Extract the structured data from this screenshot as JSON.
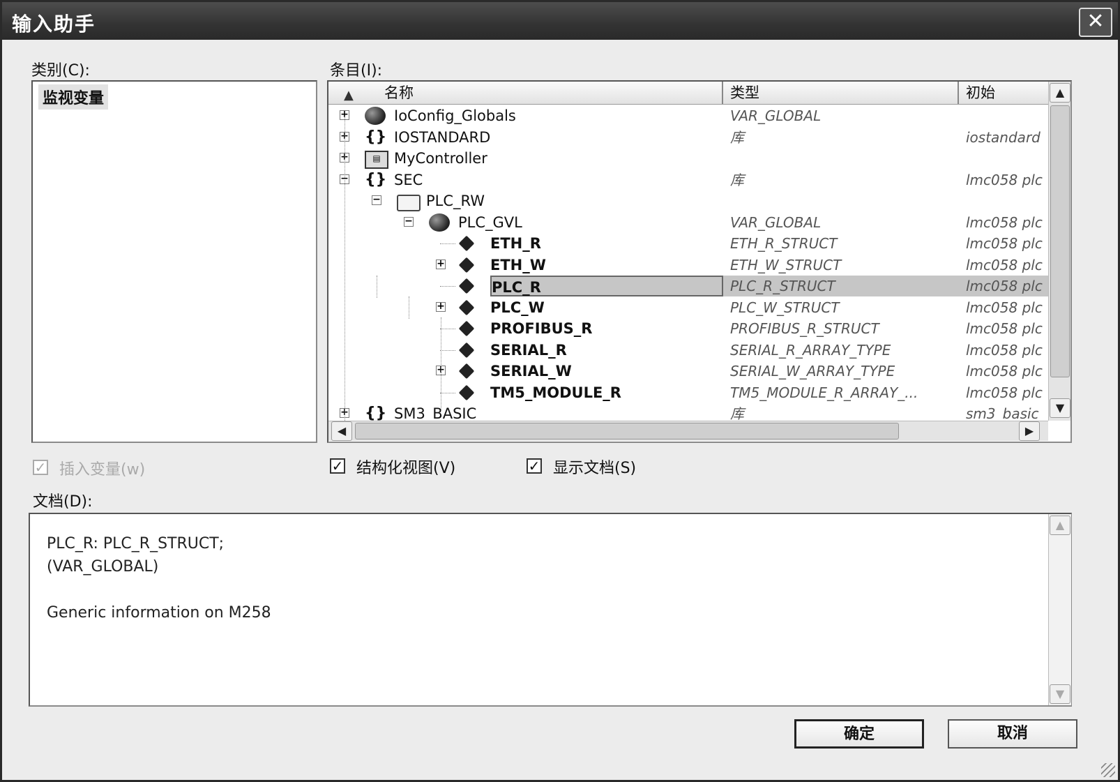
{
  "window": {
    "title": "输入助手",
    "close_glyph": "✕"
  },
  "category": {
    "label": "类别(C):",
    "items": [
      "监视变量"
    ]
  },
  "entries": {
    "label": "条目(I):",
    "columns": [
      "名称",
      "类型",
      "初始"
    ],
    "rows": [
      {
        "name": "IoConfig_Globals",
        "type": "VAR_GLOBAL",
        "init": "",
        "icon": "globe-icon",
        "expander": "+"
      },
      {
        "name": "IOSTANDARD",
        "type": "库",
        "init": "iostandard",
        "icon": "library-icon",
        "expander": "+"
      },
      {
        "name": "MyController",
        "type": "",
        "init": "",
        "icon": "controller-icon",
        "expander": "+"
      },
      {
        "name": "SEC",
        "type": "库",
        "init": "lmc058 plc",
        "icon": "library-icon",
        "expander": "−"
      },
      {
        "name": "PLC_RW",
        "type": "",
        "init": "",
        "icon": "folder-icon",
        "expander": "−"
      },
      {
        "name": "PLC_GVL",
        "type": "VAR_GLOBAL",
        "init": "lmc058 plc",
        "icon": "globe-icon",
        "expander": "−"
      },
      {
        "name": "ETH_R",
        "type": "ETH_R_STRUCT",
        "init": "lmc058 plc",
        "icon": "variable-icon",
        "expander": ""
      },
      {
        "name": "ETH_W",
        "type": "ETH_W_STRUCT",
        "init": "lmc058 plc",
        "icon": "variable-icon",
        "expander": "+"
      },
      {
        "name": "PLC_R",
        "type": "PLC_R_STRUCT",
        "init": "lmc058 plc",
        "icon": "variable-icon",
        "expander": "",
        "selected": true
      },
      {
        "name": "PLC_W",
        "type": "PLC_W_STRUCT",
        "init": "lmc058 plc",
        "icon": "variable-icon",
        "expander": "+"
      },
      {
        "name": "PROFIBUS_R",
        "type": "PROFIBUS_R_STRUCT",
        "init": "lmc058 plc",
        "icon": "variable-icon",
        "expander": ""
      },
      {
        "name": "SERIAL_R",
        "type": "SERIAL_R_ARRAY_TYPE",
        "init": "lmc058 plc",
        "icon": "variable-icon",
        "expander": ""
      },
      {
        "name": "SERIAL_W",
        "type": "SERIAL_W_ARRAY_TYPE",
        "init": "lmc058 plc",
        "icon": "variable-icon",
        "expander": "+"
      },
      {
        "name": "TM5_MODULE_R",
        "type": "TM5_MODULE_R_ARRAY_...",
        "init": "lmc058 plc",
        "icon": "variable-icon",
        "expander": ""
      },
      {
        "name": "SM3_BASIC",
        "type": "库",
        "init": "sm3_basic",
        "icon": "library-icon",
        "expander": "+"
      }
    ]
  },
  "options": {
    "insert_variable": {
      "label": "插入变量(w)",
      "checked": true,
      "disabled": true
    },
    "structured_view": {
      "label": "结构化视图(V)",
      "checked": true
    },
    "show_docs": {
      "label": "显示文档(S)",
      "checked": true
    }
  },
  "documentation": {
    "label": "文档(D):",
    "text": "PLC_R: PLC_R_STRUCT;\n(VAR_GLOBAL)\n\nGeneric information on M258"
  },
  "buttons": {
    "ok": "确定",
    "cancel": "取消"
  },
  "check_glyph": "✓"
}
